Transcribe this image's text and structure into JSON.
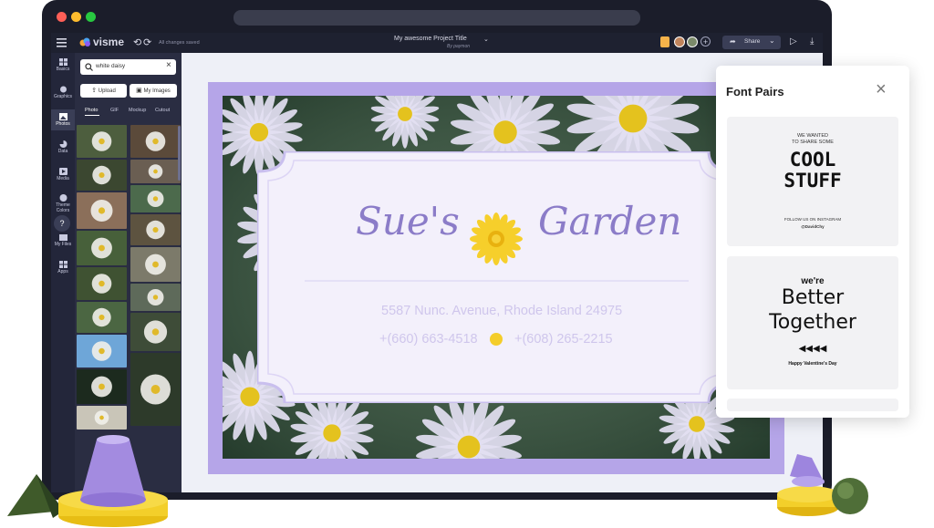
{
  "editor": {
    "logo_text": "visme",
    "save_status": "All changes saved",
    "project_title": "My awesome Project Title",
    "project_author": "By paymon",
    "share_label": "Share"
  },
  "sidebar": {
    "items": [
      {
        "label": "Basics",
        "icon": "basics-icon"
      },
      {
        "label": "Graphics",
        "icon": "graphics-icon"
      },
      {
        "label": "Photos",
        "icon": "photos-icon"
      },
      {
        "label": "Data",
        "icon": "data-icon"
      },
      {
        "label": "Media",
        "icon": "media-icon"
      },
      {
        "label": "Theme Colors",
        "icon": "palette-icon"
      },
      {
        "label": "My Files",
        "icon": "folder-icon"
      },
      {
        "label": "Apps",
        "icon": "apps-icon"
      }
    ]
  },
  "photos_panel": {
    "search_value": "white daisy",
    "upload_label": "Upload",
    "my_images_label": "My Images",
    "tabs": [
      "Photo",
      "GIF",
      "Mockup",
      "Cutout"
    ]
  },
  "design": {
    "title_left": "Sue's",
    "title_right": "Garden",
    "address": "5587 Nunc. Avenue, Rhode Island 24975",
    "phone_1": "+(660) 663-4518",
    "phone_2": "+(608) 265-2215"
  },
  "font_pairs": {
    "title": "Font Pairs",
    "card1": {
      "line1": "WE WANTED",
      "line2": "TO SHARE SOME",
      "headline1": "COOL",
      "headline2": "STUFF",
      "footer": "FOLLOW US ON INSTAGRAM",
      "handle": "@DavidChy"
    },
    "card2": {
      "line1": "we're",
      "headline1": "Better",
      "headline2": "Together",
      "footer": "Happy Valentine's Day"
    }
  },
  "colors": {
    "accent_purple": "#b5a5e8",
    "title_purple": "#8b7cc8",
    "yellow": "#f4cd2a",
    "dark_ui": "#1b1d2a"
  }
}
